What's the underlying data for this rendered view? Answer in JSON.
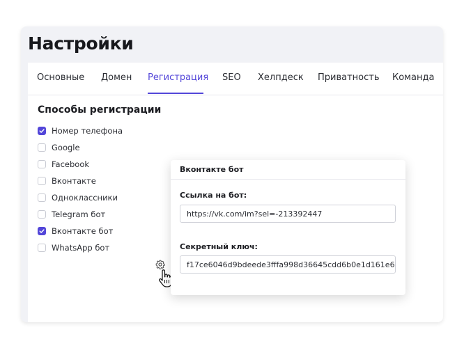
{
  "page": {
    "title": "Настройки"
  },
  "tabs": [
    {
      "label": "Основные"
    },
    {
      "label": "Домен"
    },
    {
      "label": "Регистрация"
    },
    {
      "label": "SEO"
    },
    {
      "label": "Хелпдеск"
    },
    {
      "label": "Приватность"
    },
    {
      "label": "Команда"
    }
  ],
  "active_tab": "Регистрация",
  "registration": {
    "section_title": "Способы регистрации",
    "options": [
      {
        "label": "Номер телефона",
        "checked": true
      },
      {
        "label": "Google",
        "checked": false
      },
      {
        "label": "Facebook",
        "checked": false
      },
      {
        "label": "Вконтакте",
        "checked": false
      },
      {
        "label": "Одноклассники",
        "checked": false
      },
      {
        "label": "Telegram бот",
        "checked": false
      },
      {
        "label": "Вконтакте бот",
        "checked": true
      },
      {
        "label": "WhatsApp бот",
        "checked": false
      }
    ]
  },
  "popup": {
    "title": "Вконтакте бот",
    "link_label": "Ссылка на бот:",
    "link_value": "https://vk.com/im?sel=-213392447",
    "secret_label": "Секретный ключ:",
    "secret_value": "f17ce6046d9bdeede3fffa998d36645cdd6b0e1d161e6"
  },
  "colors": {
    "accent": "#5346d9",
    "card_background": "#f1f2f6",
    "panel_background": "#ffffff"
  },
  "icons": {
    "settings": "gear-icon",
    "pointer": "hand-cursor-icon",
    "check": "checkmark-icon"
  }
}
